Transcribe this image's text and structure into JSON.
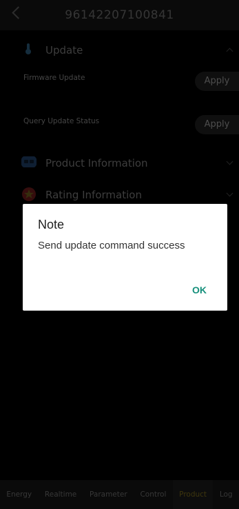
{
  "header": {
    "title": "96142207100841"
  },
  "sections": {
    "update": {
      "label": "Update",
      "rows": [
        {
          "label": "Firmware Update",
          "action": "Apply"
        },
        {
          "label": "Query Update Status",
          "action": "Apply"
        }
      ]
    },
    "product_info": {
      "label": "Product Information"
    },
    "rating_info": {
      "label": "Rating Information"
    }
  },
  "dialog": {
    "title": "Note",
    "message": "Send update command success",
    "ok_label": "OK"
  },
  "tabs": [
    {
      "label": "Energy"
    },
    {
      "label": "Realtime"
    },
    {
      "label": "Parameter"
    },
    {
      "label": "Control"
    },
    {
      "label": "Product",
      "active": true
    },
    {
      "label": "Log"
    }
  ],
  "colors": {
    "accent": "#16907c",
    "active_tab": "#c9a521",
    "background": "#000000"
  }
}
